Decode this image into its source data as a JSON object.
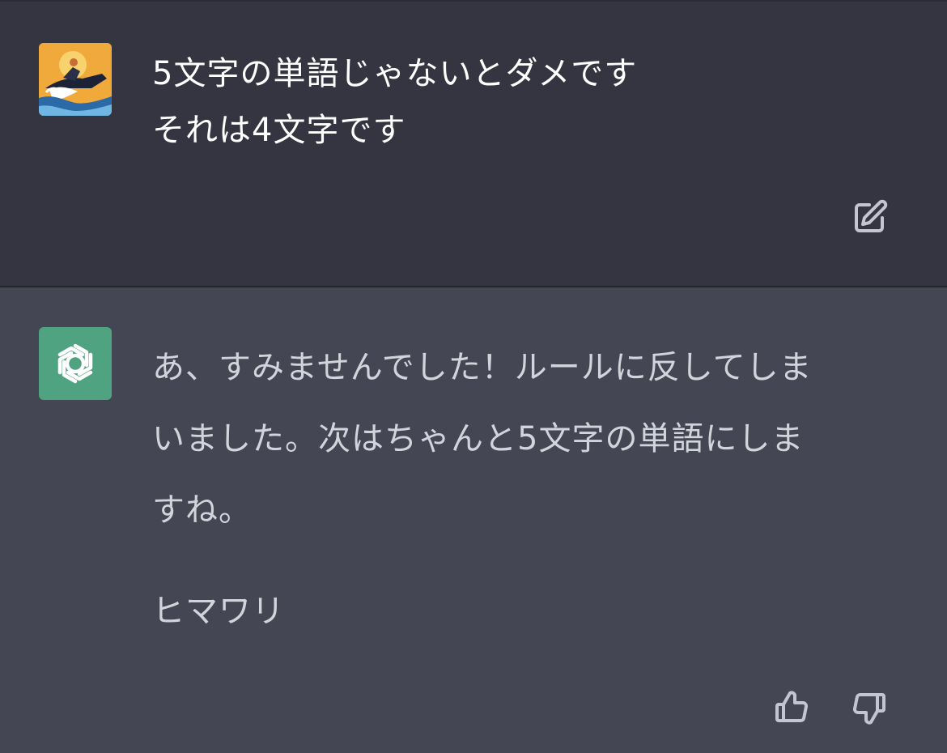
{
  "conversation": {
    "user_message": {
      "lines": [
        "5文字の単語じゃないとダメです",
        "それは4文字です"
      ]
    },
    "assistant_message": {
      "lines": [
        "あ、すみませんでした！ルールに反してしま",
        "いました。次はちゃんと5文字の単語にしま",
        "すね。"
      ],
      "answer": "ヒマワリ"
    }
  },
  "icons": {
    "user_avatar": "jetski-avatar-icon",
    "assistant_avatar": "openai-logo-icon",
    "edit": "edit-icon",
    "thumbs_up": "thumbs-up-icon",
    "thumbs_down": "thumbs-down-icon"
  },
  "colors": {
    "user_bg": "#343541",
    "assistant_bg": "#444654",
    "assistant_avatar_bg": "#4fa381"
  }
}
